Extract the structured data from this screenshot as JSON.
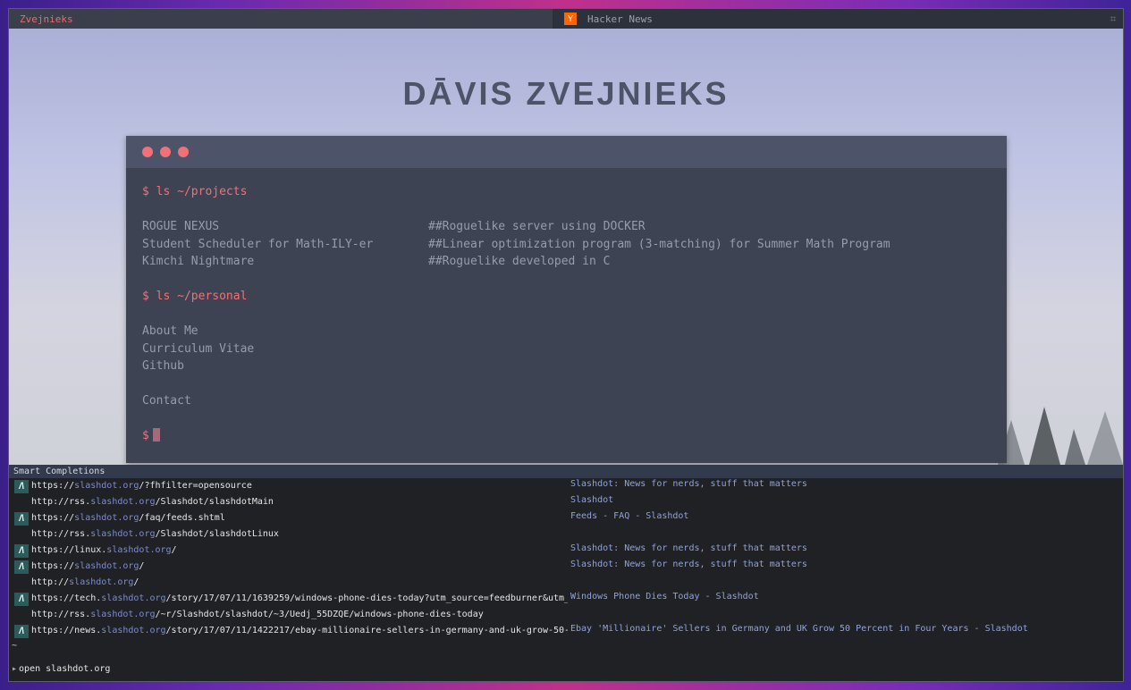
{
  "tabs": [
    {
      "title": "Zvejnieks",
      "favicon": ""
    },
    {
      "title": "Hacker News",
      "favicon": "Y"
    }
  ],
  "tab_menu_icon": "⌗",
  "page": {
    "site_title": "DĀVIS ZVEJNIEKS",
    "terminal": {
      "cmd_projects": "$ ls ~/projects",
      "projects": [
        {
          "name": "ROGUE NEXUS",
          "desc": "##Roguelike server using DOCKER"
        },
        {
          "name": "Student Scheduler for Math-ILY-er",
          "desc": "##Linear optimization program (3-matching) for Summer Math Program"
        },
        {
          "name": "Kimchi Nightmare",
          "desc": "##Roguelike developed in C"
        }
      ],
      "cmd_personal": "$ ls ~/personal",
      "personal": [
        "About Me",
        "Curriculum Vitae",
        "Github"
      ],
      "contact": "Contact",
      "prompt": "$"
    }
  },
  "completion": {
    "header": "Smart Completions",
    "items": [
      {
        "icon": true,
        "prefix": "https://",
        "host": "slashdot.org",
        "rest": "/?fhfilter=opensource",
        "title": "Slashdot: News for nerds, stuff that matters"
      },
      {
        "icon": false,
        "prefix": "http://rss.",
        "host": "slashdot.org",
        "rest": "/Slashdot/slashdotMain",
        "title": "Slashdot"
      },
      {
        "icon": true,
        "prefix": "https://",
        "host": "slashdot.org",
        "rest": "/faq/feeds.shtml",
        "title": "Feeds - FAQ - Slashdot"
      },
      {
        "icon": false,
        "prefix": "http://rss.",
        "host": "slashdot.org",
        "rest": "/Slashdot/slashdotLinux",
        "title": ""
      },
      {
        "icon": true,
        "prefix": "https://linux.",
        "host": "slashdot.org",
        "rest": "/",
        "title": "Slashdot: News for nerds, stuff that matters"
      },
      {
        "icon": true,
        "prefix": "https://",
        "host": "slashdot.org",
        "rest": "/",
        "title": "Slashdot: News for nerds, stuff that matters"
      },
      {
        "icon": false,
        "prefix": "http://",
        "host": "slashdot.org",
        "rest": "/",
        "title": ""
      },
      {
        "icon": true,
        "prefix": "https://tech.",
        "host": "slashdot.org",
        "rest": "/story/17/07/11/1639259/windows-phone-dies-today?utm_source=feedburner&utm_",
        "title": "Windows Phone Dies Today - Slashdot"
      },
      {
        "icon": false,
        "prefix": "http://rss.",
        "host": "slashdot.org",
        "rest": "/~r/Slashdot/slashdot/~3/Uedj_55DZQE/windows-phone-dies-today",
        "title": ""
      },
      {
        "icon": true,
        "prefix": "https://news.",
        "host": "slashdot.org",
        "rest": "/story/17/07/11/1422217/ebay-millionaire-sellers-in-germany-and-uk-grow-50-",
        "title": "Ebay 'Millionaire' Sellers in Germany and UK Grow 50 Percent in Four Years - Slashdot"
      }
    ],
    "icon_glyph": "/\\",
    "tilde": "~",
    "command": "open slashdot.org"
  }
}
